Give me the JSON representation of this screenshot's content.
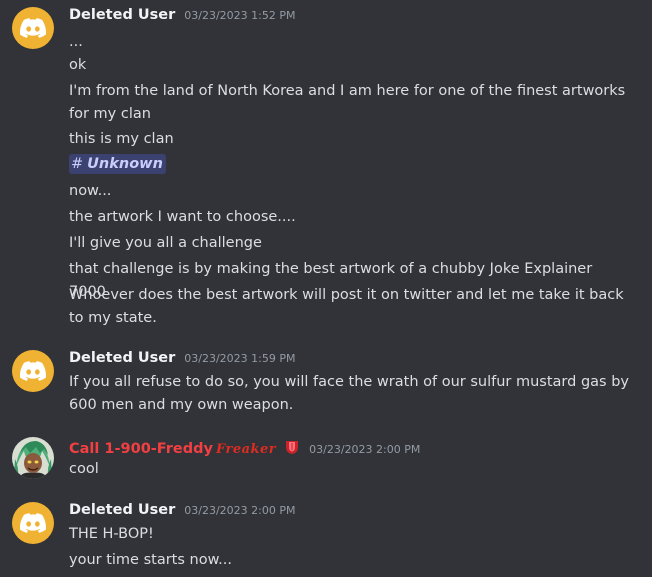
{
  "colors": {
    "background": "#313338",
    "text": "#dbdee1",
    "timestamp": "#949ba4",
    "avatar_default": "#f0b232",
    "red_name": "#f23f42",
    "mention_bg": "#3c4270",
    "mention_text": "#c9cdfb"
  },
  "messages": [
    {
      "author": "Deleted User",
      "timestamp": "03/23/2023 1:52 PM",
      "avatar_icon": "discord-logo-icon",
      "lines": [
        "...",
        "ok",
        "I'm from the land of North Korea and I am here for one of the finest artworks for my clan",
        "this is my clan",
        "now...",
        "the artwork I want to choose....",
        "I'll give you all a challenge",
        "that challenge is by making the best artwork of a chubby Joke Explainer 7000",
        "Whoever does the best artwork will post it on twitter and let me take it back to my state."
      ],
      "channel_mention": {
        "hash": "#",
        "name": "Unknown"
      }
    },
    {
      "author": "Deleted User",
      "timestamp": "03/23/2023 1:59 PM",
      "avatar_icon": "discord-logo-icon",
      "lines": [
        "If you all refuse to do so, you will face the wrath of our sulfur mustard gas by 600 men and my own weapon."
      ]
    },
    {
      "author": "Call 1-900-Freddy",
      "author_suffix": "Freaker",
      "role_icon": "tongue-emoji-icon",
      "timestamp": "03/23/2023 2:00 PM",
      "avatar_icon": "user-avatar-image",
      "lines": [
        "cool"
      ]
    },
    {
      "author": "Deleted User",
      "timestamp": "03/23/2023 2:00 PM",
      "avatar_icon": "discord-logo-icon",
      "lines": [
        "THE H-BOP!",
        "your time starts now..."
      ]
    }
  ]
}
